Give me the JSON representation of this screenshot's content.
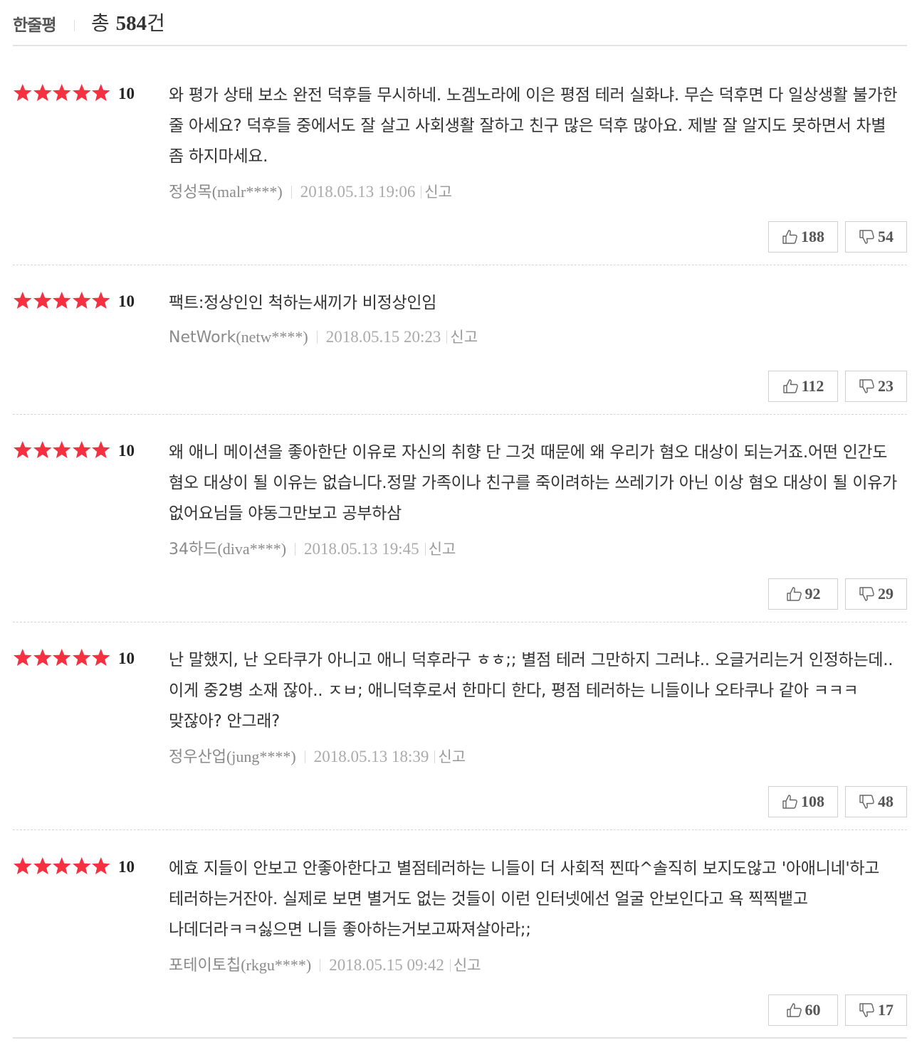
{
  "header": {
    "title": "한줄평",
    "total_prefix": "총 ",
    "total_count": "584",
    "total_suffix": "건"
  },
  "report_label": "신고",
  "max_stars": 5,
  "reviews": [
    {
      "stars": 5,
      "score": "10",
      "text": "와 평가 상태 보소 완전 덕후들 무시하네. 노겜노라에 이은 평점 테러 실화냐. 무슨 덕후면 다 일상생활 불가한 줄 아세요? 덕후들 중에서도 잘 살고 사회생활 잘하고 친구 많은 덕후 많아요. 제발 잘 알지도 못하면서 차별 좀 하지마세요.",
      "writer_name": "정성목",
      "writer_id": "(malr****)",
      "date": "2018.05.13 19:06",
      "likes": "188",
      "dislikes": "54"
    },
    {
      "stars": 5,
      "score": "10",
      "text": "팩트:정상인인 척하는새끼가 비정상인임",
      "writer_name": "NetWork",
      "writer_id": "(netw****)",
      "date": "2018.05.15 20:23",
      "likes": "112",
      "dislikes": "23"
    },
    {
      "stars": 5,
      "score": "10",
      "text": "왜 애니 메이션을 좋아한단 이유로 자신의 취향 단 그것 때문에 왜 우리가 혐오 대상이 되는거죠.어떤 인간도 혐오 대상이 될 이유는 없습니다.정말 가족이나 친구를 죽이려하는 쓰레기가 아닌 이상 혐오 대상이 될 이유가 없어요님들 야동그만보고 공부하삼",
      "writer_name": "34하드",
      "writer_id": "(diva****)",
      "date": "2018.05.13 19:45",
      "likes": "92",
      "dislikes": "29"
    },
    {
      "stars": 5,
      "score": "10",
      "text": "난 말했지, 난 오타쿠가 아니고 애니 덕후라구 ㅎㅎ;; 별점 테러 그만하지 그러냐.. 오글거리는거 인정하는데.. 이게 중2병 소재 잖아.. ㅈㅂ; 애니덕후로서 한마디 한다, 평점 테러하는 니들이나 오타쿠나 같아 ㅋㅋㅋ 맞잖아? 안그래?",
      "writer_name": "정우산업",
      "writer_id": "(jung****)",
      "date": "2018.05.13 18:39",
      "likes": "108",
      "dislikes": "48"
    },
    {
      "stars": 5,
      "score": "10",
      "text": "에효 지들이 안보고 안좋아한다고 별점테러하는 니들이 더 사회적 찐따^솔직히 보지도않고 '아애니네'하고 테러하는거잔아. 실제로 보면 별거도 없는 것들이 이런 인터넷에선 얼굴 안보인다고 욕 찍찍뱉고 나데더라ㅋㅋ싫으면 니들 좋아하는거보고짜져살아라;;",
      "writer_name": "포테이토칩",
      "writer_id": "(rkgu****)",
      "date": "2018.05.15 09:42",
      "likes": "60",
      "dislikes": "17"
    }
  ],
  "icons": {
    "like": "thumbs-up-icon",
    "dislike": "thumbs-down-icon",
    "star": "star-icon"
  },
  "colors": {
    "star": "#f43041",
    "divider": "#e2e2e2",
    "meta_text": "#999999"
  }
}
